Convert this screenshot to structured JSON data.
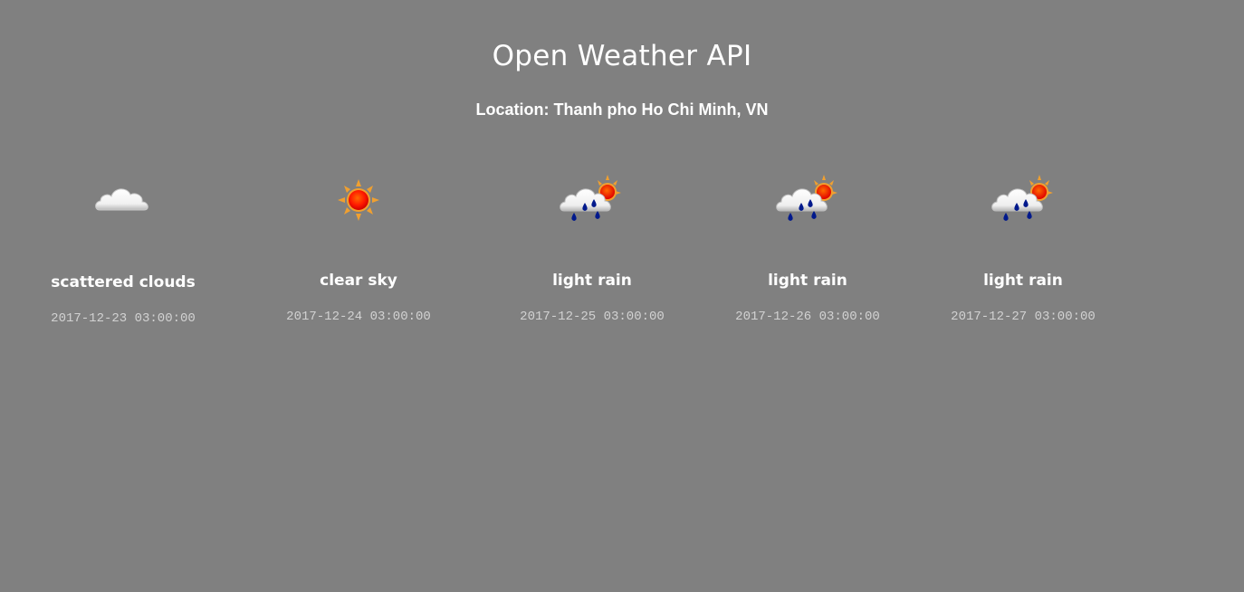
{
  "header": {
    "title": "Open Weather API",
    "location": "Location: Thanh pho Ho Chi Minh, VN"
  },
  "forecast": [
    {
      "icon": "cloud-icon",
      "description": "scattered clouds",
      "datetime": "2017-12-23 03:00:00"
    },
    {
      "icon": "sun-icon",
      "description": "clear sky",
      "datetime": "2017-12-24 03:00:00"
    },
    {
      "icon": "rain-icon",
      "description": "light rain",
      "datetime": "2017-12-25 03:00:00"
    },
    {
      "icon": "rain-icon",
      "description": "light rain",
      "datetime": "2017-12-26 03:00:00"
    },
    {
      "icon": "rain-icon",
      "description": "light rain",
      "datetime": "2017-12-27 03:00:00"
    }
  ],
  "colors": {
    "background": "#808080",
    "text": "#ffffff",
    "timestamp": "#d2d2d2",
    "raindrop": "#00198c",
    "sun_core": "#ff1a00",
    "sun_rays": "#f0a030"
  }
}
